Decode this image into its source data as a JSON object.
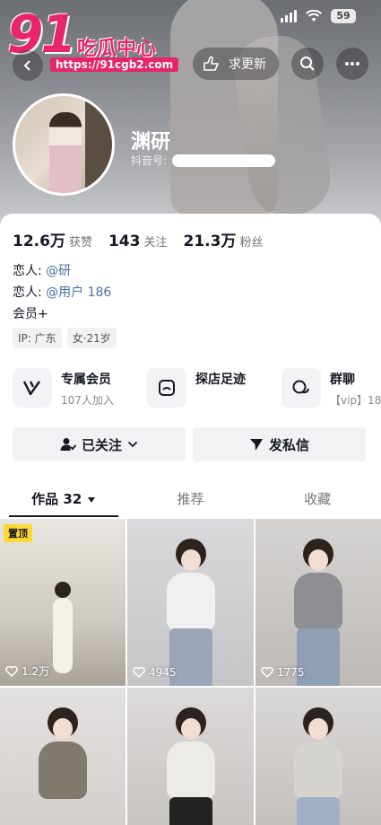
{
  "status_bar": {
    "battery": "59"
  },
  "watermark": {
    "brand_number": "91",
    "brand_text": "吃瓜中心",
    "url": "https://91cgb2.com"
  },
  "header": {
    "request_update_label": "求更新"
  },
  "profile": {
    "username": "渊研",
    "douyin_id_label": "抖音号:"
  },
  "stats": [
    {
      "num": "12.6万",
      "label": "获赞"
    },
    {
      "num": "143",
      "label": "关注"
    },
    {
      "num": "21.3万",
      "label": "粉丝"
    }
  ],
  "bio": {
    "lover1_prefix": "恋人: ",
    "lover1_handle": "@研",
    "lover2_prefix": "恋人: ",
    "lover2_handle": "@用户 186",
    "member": "会员+"
  },
  "tags": [
    "IP: 广东",
    "女·21岁"
  ],
  "features": [
    {
      "title": "专属会员",
      "subtitle": "107人加入"
    },
    {
      "title": "探店足迹",
      "subtitle": ""
    },
    {
      "title": "群聊",
      "subtitle": "【vip】18"
    }
  ],
  "actions": {
    "followed_label": "已关注",
    "message_label": "发私信"
  },
  "tabs": [
    {
      "label": "作品 32"
    },
    {
      "label": "推荐"
    },
    {
      "label": "收藏"
    }
  ],
  "videos": [
    {
      "likes": "1.2万",
      "pinned_label": "置顶"
    },
    {
      "likes": "4945"
    },
    {
      "likes": "1775"
    },
    {
      "likes": ""
    },
    {
      "likes": ""
    },
    {
      "likes": ""
    }
  ]
}
